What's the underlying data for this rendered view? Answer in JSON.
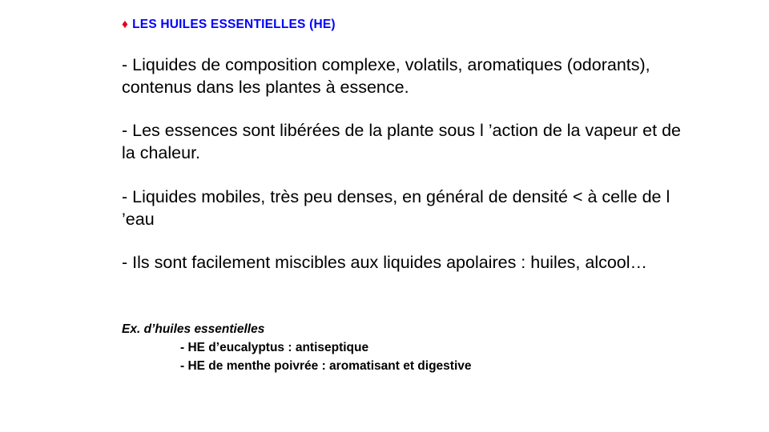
{
  "title": {
    "bullet": "♦",
    "text": "LES HUILES ESSENTIELLES (HE)"
  },
  "paragraphs": [
    "- Liquides  de composition complexe, volatils, aromatiques (odorants), contenus dans les plantes à essence.",
    "- Les essences sont libérées de la plante sous l ’action de la vapeur et de la chaleur.",
    "- Liquides mobiles, très peu denses, en général de densité < à celle de l ’eau",
    "- Ils sont facilement miscibles aux liquides apolaires : huiles, alcool…"
  ],
  "examples": {
    "heading": "Ex. d’huiles essentielles",
    "items": [
      "- HE d’eucalyptus : antiseptique",
      "- HE de menthe poivrée : aromatisant et digestive"
    ]
  },
  "colors": {
    "title": "#0000ff",
    "bullet": "#e3001b",
    "text": "#000000",
    "background": "#ffffff"
  }
}
